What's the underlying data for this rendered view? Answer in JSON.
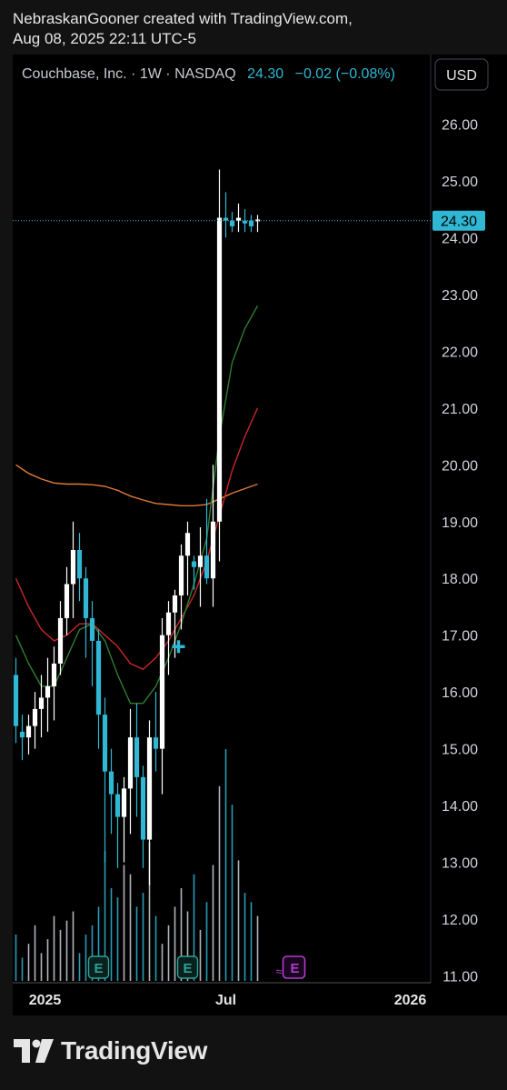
{
  "header": {
    "attribution": "NebraskanGooner created with TradingView.com,",
    "timestamp": "Aug 08, 2025 22:11 UTC-5"
  },
  "legend": {
    "symbol": "Couchbase, Inc. · 1W · NASDAQ",
    "price": "24.30",
    "change": "−0.02 (−0.08%)"
  },
  "currency_button": "USD",
  "last_price_label": "24.30",
  "footer": {
    "brand": "TradingView"
  },
  "colors": {
    "up": "#ffffff",
    "down": "#2fb7d3",
    "sma_short": "#2e7d32",
    "sma_mid": "#c62828",
    "sma_long": "#e07b39",
    "earnings": "#26a69a",
    "dividend": "#b03cc9",
    "price_line": "#2fb7d3"
  },
  "chart_data": {
    "type": "candlestick",
    "timeframe": "1W",
    "y_ticks": [
      "26.00",
      "25.00",
      "24.00",
      "23.00",
      "22.00",
      "21.00",
      "20.00",
      "19.00",
      "18.00",
      "17.00",
      "16.00",
      "15.00",
      "14.00",
      "13.00",
      "12.00",
      "11.00"
    ],
    "ylim": [
      11,
      26
    ],
    "x_ticks": [
      {
        "label": "2025",
        "bar": 2
      },
      {
        "label": "Jul",
        "bar": 33
      },
      {
        "label": "2026",
        "bar": 62
      }
    ],
    "candles": [
      [
        16.3,
        16.6,
        15.1,
        15.4
      ],
      [
        15.3,
        15.6,
        14.8,
        15.2
      ],
      [
        15.2,
        15.6,
        14.9,
        15.4
      ],
      [
        15.4,
        16.0,
        15.0,
        15.7
      ],
      [
        15.7,
        16.3,
        15.2,
        15.9
      ],
      [
        15.9,
        16.6,
        15.3,
        16.1
      ],
      [
        16.1,
        16.8,
        15.5,
        16.5
      ],
      [
        16.5,
        17.6,
        16.3,
        17.3
      ],
      [
        17.3,
        18.2,
        17.0,
        17.9
      ],
      [
        17.9,
        19.0,
        17.3,
        18.5
      ],
      [
        18.5,
        18.8,
        17.6,
        18.0
      ],
      [
        18.0,
        18.2,
        16.6,
        17.3
      ],
      [
        17.3,
        17.6,
        16.1,
        16.9
      ],
      [
        16.9,
        17.1,
        15.0,
        15.6
      ],
      [
        15.6,
        15.9,
        13.0,
        14.6
      ],
      [
        14.6,
        15.0,
        13.5,
        14.2
      ],
      [
        14.2,
        14.4,
        12.9,
        13.8
      ],
      [
        13.8,
        14.5,
        13.0,
        14.3
      ],
      [
        14.3,
        15.7,
        13.5,
        15.2
      ],
      [
        15.2,
        15.8,
        13.8,
        14.5
      ],
      [
        14.5,
        14.7,
        12.9,
        13.4
      ],
      [
        13.4,
        15.5,
        12.6,
        15.2
      ],
      [
        15.2,
        16.0,
        14.6,
        15.0
      ],
      [
        15.0,
        17.3,
        14.2,
        17.0
      ],
      [
        17.0,
        17.6,
        16.3,
        17.4
      ],
      [
        17.4,
        17.8,
        16.6,
        17.7
      ],
      [
        17.7,
        18.6,
        17.1,
        18.4
      ],
      [
        18.4,
        19.0,
        17.7,
        18.8
      ],
      [
        18.3,
        18.4,
        17.8,
        18.2
      ],
      [
        18.2,
        18.9,
        17.5,
        18.4
      ],
      [
        18.4,
        19.4,
        17.9,
        18.0
      ],
      [
        18.0,
        20.0,
        17.5,
        19.0
      ],
      [
        19.0,
        25.2,
        18.3,
        24.35
      ],
      [
        24.35,
        24.8,
        24.0,
        24.3
      ],
      [
        24.3,
        24.45,
        24.1,
        24.2
      ],
      [
        24.3,
        24.6,
        24.1,
        24.35
      ],
      [
        24.3,
        24.5,
        24.1,
        24.25
      ],
      [
        24.3,
        24.4,
        24.1,
        24.2
      ],
      [
        24.3,
        24.4,
        24.1,
        24.32
      ]
    ],
    "volume": [
      10,
      5,
      8,
      12,
      6,
      9,
      14,
      11,
      13,
      15,
      6,
      10,
      12,
      16,
      28,
      20,
      18,
      25,
      23,
      16,
      19,
      30,
      14,
      8,
      12,
      16,
      20,
      15,
      23,
      11,
      17,
      25,
      42,
      50,
      38,
      26,
      19,
      17,
      14
    ],
    "earnings_markers": [
      13,
      27
    ],
    "dividend_marker_bar": 40,
    "cross_marker": {
      "bar": 24,
      "price": 16.8
    },
    "sma_short": [
      [
        0,
        17.0
      ],
      [
        2,
        16.5
      ],
      [
        4,
        16.1
      ],
      [
        6,
        16.1
      ],
      [
        8,
        16.6
      ],
      [
        10,
        17.1
      ],
      [
        12,
        17.2
      ],
      [
        14,
        16.9
      ],
      [
        16,
        16.3
      ],
      [
        18,
        15.8
      ],
      [
        20,
        15.8
      ],
      [
        22,
        16.1
      ],
      [
        24,
        16.6
      ],
      [
        26,
        17.2
      ],
      [
        28,
        17.9
      ],
      [
        30,
        18.7
      ],
      [
        32,
        20.5
      ],
      [
        34,
        21.8
      ],
      [
        36,
        22.4
      ],
      [
        38,
        22.8
      ]
    ],
    "sma_mid": [
      [
        0,
        18.0
      ],
      [
        2,
        17.5
      ],
      [
        4,
        17.1
      ],
      [
        6,
        16.9
      ],
      [
        8,
        17.0
      ],
      [
        10,
        17.2
      ],
      [
        12,
        17.2
      ],
      [
        14,
        17.0
      ],
      [
        16,
        16.8
      ],
      [
        18,
        16.5
      ],
      [
        20,
        16.4
      ],
      [
        22,
        16.6
      ],
      [
        24,
        16.9
      ],
      [
        26,
        17.3
      ],
      [
        28,
        17.7
      ],
      [
        30,
        18.3
      ],
      [
        32,
        19.1
      ],
      [
        34,
        19.9
      ],
      [
        36,
        20.5
      ],
      [
        38,
        21.0
      ]
    ],
    "sma_long": [
      [
        0,
        20.0
      ],
      [
        2,
        19.85
      ],
      [
        4,
        19.75
      ],
      [
        6,
        19.68
      ],
      [
        8,
        19.66
      ],
      [
        10,
        19.66
      ],
      [
        12,
        19.65
      ],
      [
        14,
        19.62
      ],
      [
        16,
        19.55
      ],
      [
        18,
        19.45
      ],
      [
        20,
        19.38
      ],
      [
        22,
        19.32
      ],
      [
        24,
        19.3
      ],
      [
        26,
        19.28
      ],
      [
        28,
        19.28
      ],
      [
        30,
        19.3
      ],
      [
        32,
        19.4
      ],
      [
        34,
        19.5
      ],
      [
        36,
        19.58
      ],
      [
        38,
        19.66
      ]
    ]
  }
}
